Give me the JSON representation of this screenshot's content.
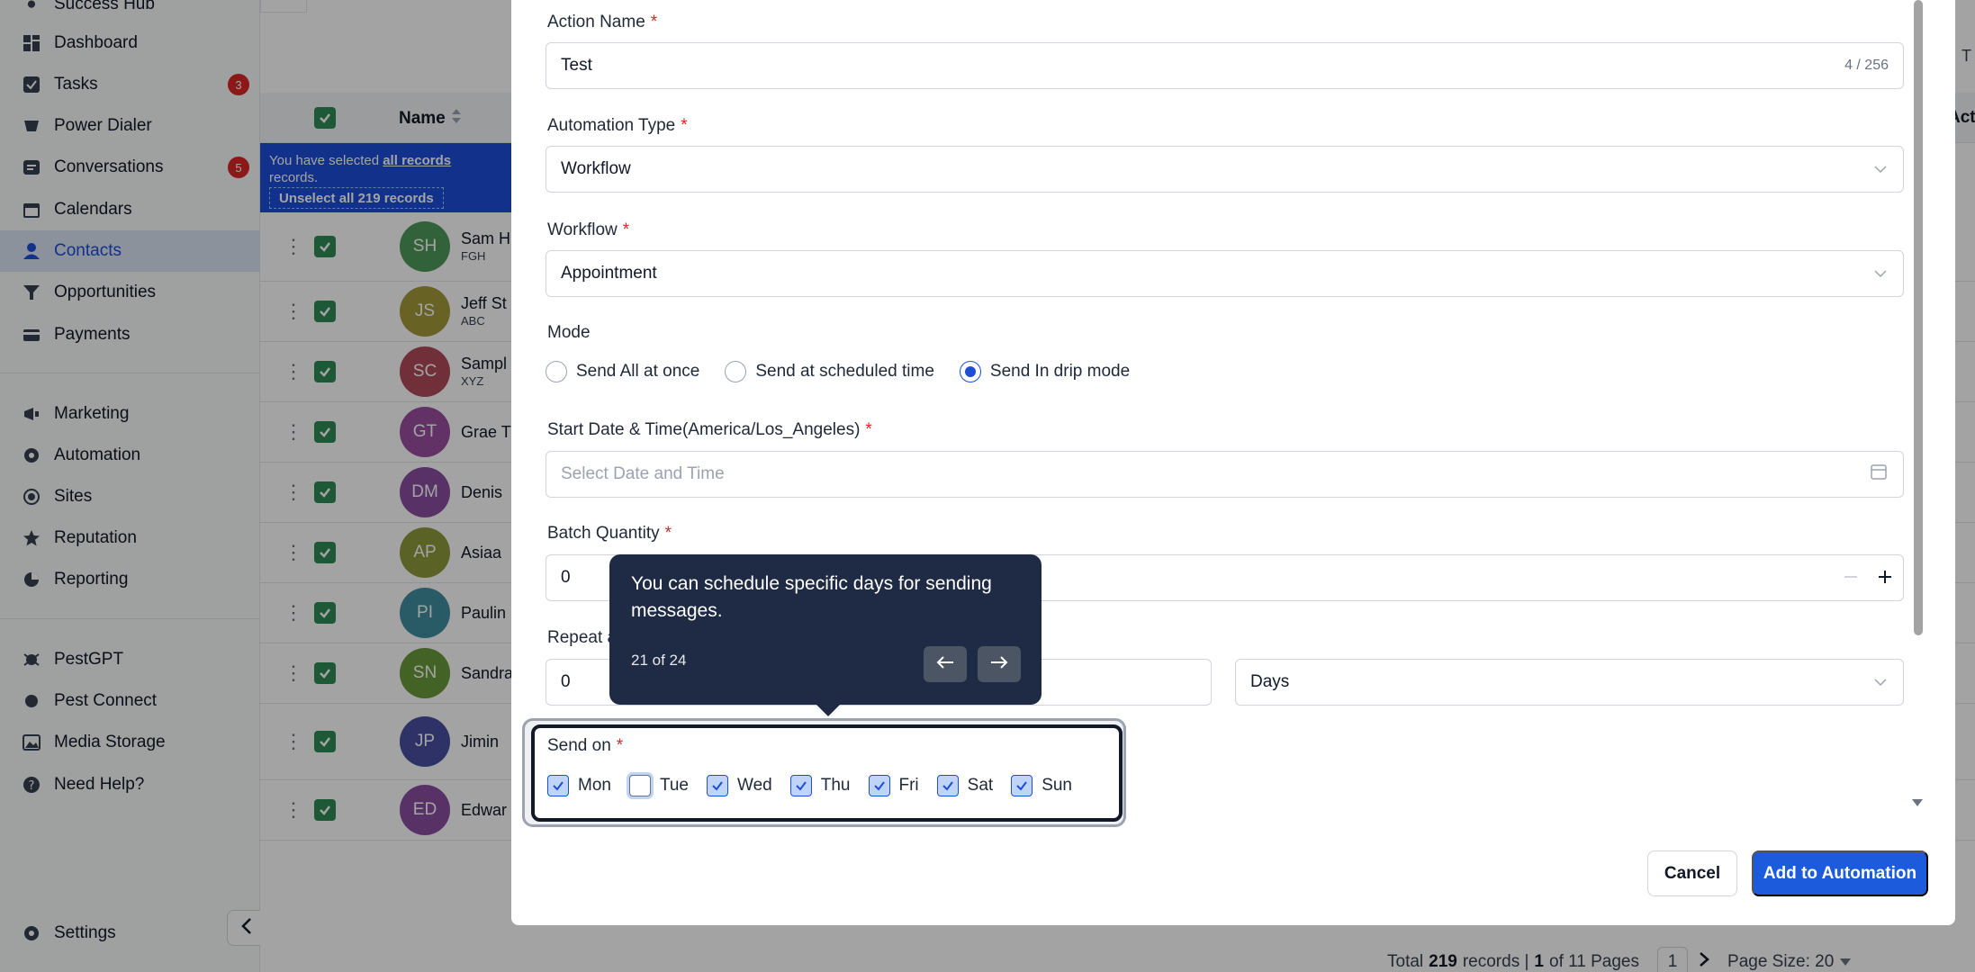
{
  "sidebar": {
    "top_partial": "Success Hub",
    "items": [
      {
        "label": "Dashboard",
        "icon": "dashboard-icon"
      },
      {
        "label": "Tasks",
        "icon": "tasks-icon",
        "badge": "3"
      },
      {
        "label": "Power Dialer",
        "icon": "power-dialer-icon"
      },
      {
        "label": "Conversations",
        "icon": "conversations-icon",
        "badge": "5"
      },
      {
        "label": "Calendars",
        "icon": "calendar-icon"
      },
      {
        "label": "Contacts",
        "icon": "contacts-icon",
        "active": true
      },
      {
        "label": "Opportunities",
        "icon": "opportunities-icon"
      },
      {
        "label": "Payments",
        "icon": "payments-icon"
      },
      {
        "label": "Marketing",
        "icon": "marketing-icon"
      },
      {
        "label": "Automation",
        "icon": "automation-icon"
      },
      {
        "label": "Sites",
        "icon": "sites-icon"
      },
      {
        "label": "Reputation",
        "icon": "reputation-icon"
      },
      {
        "label": "Reporting",
        "icon": "reporting-icon"
      },
      {
        "label": "PestGPT",
        "icon": "pestgpt-icon"
      },
      {
        "label": "Pest Connect",
        "icon": "pest-connect-icon"
      },
      {
        "label": "Media Storage",
        "icon": "media-storage-icon"
      },
      {
        "label": "Need Help?",
        "icon": "help-icon"
      },
      {
        "label": "Settings",
        "icon": "settings-icon"
      }
    ]
  },
  "table": {
    "name_header": "Name",
    "banner_text_1": "You have selected ",
    "banner_link": "all records",
    "banner_text_2": "records.",
    "unselect_button": "Unselect all 219 records",
    "rows": [
      {
        "initials": "SH",
        "name": "Sam H",
        "sub": "FGH",
        "color": "#4f9a5a"
      },
      {
        "initials": "JS",
        "name": "Jeff St",
        "sub": "ABC",
        "color": "#a59a3a"
      },
      {
        "initials": "SC",
        "name": "Sampl",
        "sub": "XYZ",
        "color": "#b04a5a"
      },
      {
        "initials": "GT",
        "name": "Grae T",
        "sub": "",
        "color": "#9a4fa0"
      },
      {
        "initials": "DM",
        "name": "Denis",
        "sub": "",
        "color": "#8a4fa0"
      },
      {
        "initials": "AP",
        "name": "Asiaa",
        "sub": "",
        "color": "#8f9a3a"
      },
      {
        "initials": "PI",
        "name": "Paulin",
        "sub": "",
        "color": "#3f8fa0"
      },
      {
        "initials": "SN",
        "name": "Sandra",
        "sub": "",
        "color": "#6a9a3a"
      },
      {
        "initials": "JP",
        "name": "Jimin",
        "sub": "",
        "color": "#4a4fa0"
      },
      {
        "initials": "ED",
        "name": "Edwar",
        "sub": "",
        "color": "#8a4fa0"
      }
    ],
    "right_partial_top": "T",
    "right_partial_header": "Act"
  },
  "footer": {
    "total_prefix": "Total",
    "total_count": "219",
    "records_label": "records |",
    "page_current": "1",
    "page_of": "of 11 Pages",
    "page_box": "1",
    "page_size": "Page Size: 20"
  },
  "modal": {
    "action_name_label": "Action Name",
    "action_name_value": "Test",
    "action_name_counter": "4 / 256",
    "automation_type_label": "Automation Type",
    "automation_type_value": "Workflow",
    "workflow_label": "Workflow",
    "workflow_value": "Appointment",
    "mode_label": "Mode",
    "mode_options": [
      "Send All at once",
      "Send at scheduled time",
      "Send In drip mode"
    ],
    "mode_selected": "Send In drip mode",
    "start_label": "Start Date & Time(America/Los_Angeles)",
    "start_placeholder": "Select Date and Time",
    "batch_label": "Batch Quantity",
    "batch_value": "0",
    "repeat_label_partial": "Repeat a",
    "repeat_value": "0",
    "repeat_unit": "Days",
    "send_on_label": "Send on",
    "days": [
      {
        "label": "Mon",
        "checked": true
      },
      {
        "label": "Tue",
        "checked": false
      },
      {
        "label": "Wed",
        "checked": true
      },
      {
        "label": "Thu",
        "checked": true
      },
      {
        "label": "Fri",
        "checked": true
      },
      {
        "label": "Sat",
        "checked": true
      },
      {
        "label": "Sun",
        "checked": true
      }
    ],
    "required_mark": "*",
    "cancel_label": "Cancel",
    "add_label": "Add to Automation"
  },
  "tooltip": {
    "message": "You can schedule specific days for sending messages.",
    "step": "21 of 24"
  },
  "colors": {
    "accent": "#1d4ed8",
    "tooltip_bg": "#1f2a44",
    "required": "#dc2626",
    "badge": "#dc2626"
  }
}
